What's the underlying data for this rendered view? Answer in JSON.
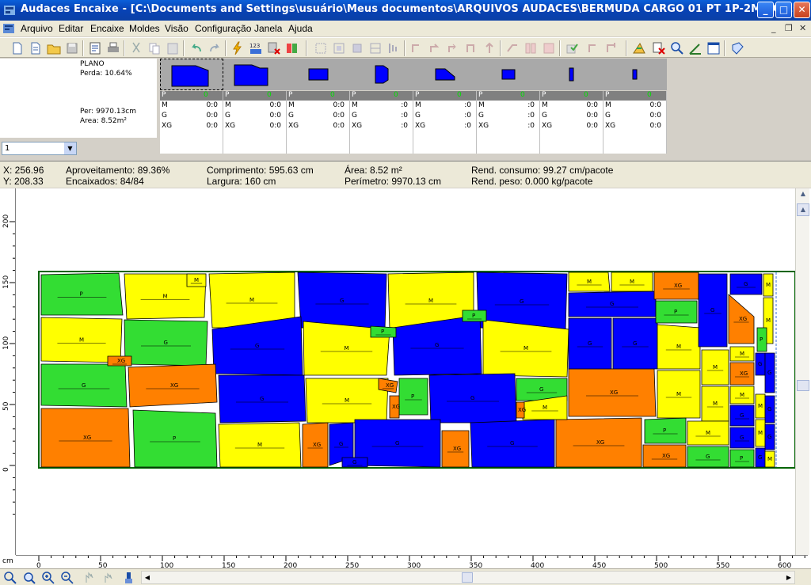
{
  "window": {
    "title": "Audaces Encaixe - [C:\\Documents and Settings\\usuário\\Meus documentos\\ARQUIVOS AUDACES\\BERMUDA CARGO 01 PT 1P-2M-2G-1GG TEC 160.amk]",
    "minimize": "_",
    "maximize": "□",
    "close": "✕"
  },
  "menu": {
    "items": [
      "Arquivo",
      "Editar",
      "Encaixe",
      "Moldes",
      "Visão",
      "Configuração",
      "Janela",
      "Ajuda"
    ],
    "mdi_minimize": "_",
    "mdi_restore": "❐",
    "mdi_close": "✕"
  },
  "plan": {
    "title": "PLANO",
    "perda": "Perda: 10.64%",
    "per": "Per: 9970.13cm",
    "area": "Area: 8.52m²",
    "selected_plan": "1"
  },
  "size_columns": [
    {
      "header": "P",
      "qty": "0",
      "rows": [
        {
          "size": "M",
          "value": "0:0"
        },
        {
          "size": "G",
          "value": "0:0"
        },
        {
          "size": "XG",
          "value": "0:0"
        }
      ]
    },
    {
      "header": "P",
      "qty": "0",
      "rows": [
        {
          "size": "M",
          "value": "0:0"
        },
        {
          "size": "G",
          "value": "0:0"
        },
        {
          "size": "XG",
          "value": "0:0"
        }
      ]
    },
    {
      "header": "P",
      "qty": "0",
      "rows": [
        {
          "size": "M",
          "value": "0:0"
        },
        {
          "size": "G",
          "value": "0:0"
        },
        {
          "size": "XG",
          "value": "0:0"
        }
      ]
    },
    {
      "header": "P",
      "qty": "0",
      "rows": [
        {
          "size": "M",
          "value": ":0"
        },
        {
          "size": "G",
          "value": ":0"
        },
        {
          "size": "XG",
          "value": ":0"
        }
      ]
    },
    {
      "header": "P",
      "qty": "0",
      "rows": [
        {
          "size": "M",
          "value": ":0"
        },
        {
          "size": "G",
          "value": ":0"
        },
        {
          "size": "XG",
          "value": ":0"
        }
      ]
    },
    {
      "header": "P",
      "qty": "0",
      "rows": [
        {
          "size": "M",
          "value": ":0"
        },
        {
          "size": "G",
          "value": ":0"
        },
        {
          "size": "XG",
          "value": ":0"
        }
      ]
    },
    {
      "header": "P",
      "qty": "0",
      "rows": [
        {
          "size": "M",
          "value": "0:0"
        },
        {
          "size": "G",
          "value": "0:0"
        },
        {
          "size": "XG",
          "value": "0:0"
        }
      ]
    },
    {
      "header": "P",
      "qty": "0",
      "rows": [
        {
          "size": "M",
          "value": "0:0"
        },
        {
          "size": "G",
          "value": "0:0"
        },
        {
          "size": "XG",
          "value": "0:0"
        }
      ]
    }
  ],
  "status": {
    "x": "X: 256.96",
    "y": "Y: 208.33",
    "aproveitamento": "Aproveitamento: 89.36%",
    "encaixados": "Encaixados: 84/84",
    "comprimento": "Comprimento: 595.63 cm",
    "largura": "Largura: 160 cm",
    "area": "Área: 8.52 m²",
    "perimetro": "Perímetro: 9970.13 cm",
    "rend_consumo": "Rend. consumo: 99.27 cm/pacote",
    "rend_peso": "Rend. peso: 0.000 kg/pacote"
  },
  "rulers": {
    "unit": "cm",
    "x_ticks": [
      "0",
      "50",
      "100",
      "150",
      "200",
      "250",
      "300",
      "350",
      "400",
      "450",
      "500",
      "550",
      "600"
    ],
    "y_ticks": [
      "200",
      "150",
      "100",
      "50",
      "0"
    ]
  },
  "colors": {
    "blue": "#0000ff",
    "yellow": "#ffff00",
    "green": "#33dd33",
    "orange": "#ff8000",
    "marker_border": "#006400"
  },
  "piece_labels": {
    "size_p": "P",
    "size_m": "M",
    "size_g": "G",
    "size_xg": "XG"
  }
}
